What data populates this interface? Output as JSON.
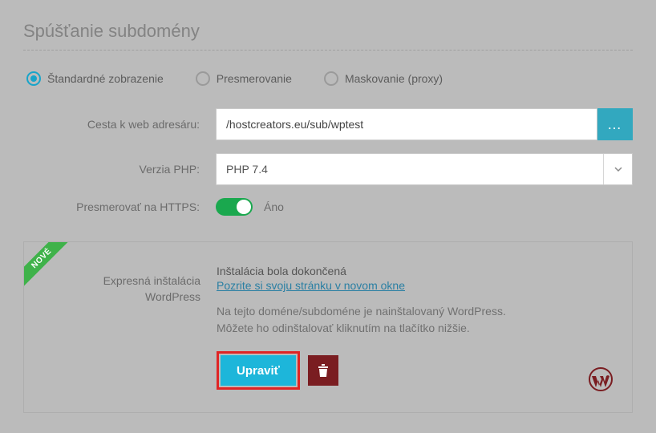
{
  "title": "Spúšťanie subdomény",
  "radios": {
    "standard": "Štandardné zobrazenie",
    "redirect": "Presmerovanie",
    "proxy": "Maskovanie (proxy)"
  },
  "form": {
    "path_label": "Cesta k web adresáru:",
    "path_value": "/hostcreators.eu/sub/wptest",
    "php_label": "Verzia PHP:",
    "php_value": "PHP 7.4",
    "https_label": "Presmerovať na HTTPS:",
    "https_value": "Áno"
  },
  "install": {
    "ribbon": "NOVÉ",
    "heading_line1": "Expresná inštalácia",
    "heading_line2": "WordPress",
    "status": "Inštalácia bola dokončená",
    "link": "Pozrite si svoju stránku v novom okne",
    "desc_line1": "Na tejto doméne/subdoméne je nainštalovaný WordPress.",
    "desc_line2": "Môžete ho odinštalovať kliknutím na tlačítko nižšie.",
    "edit_btn": "Upraviť"
  }
}
